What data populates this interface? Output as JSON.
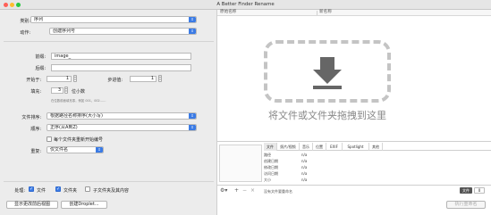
{
  "window": {
    "title": "A Better Finder Rename"
  },
  "form": {
    "category_label": "类别:",
    "category_value": "序列",
    "action_label": "动作:",
    "action_value": "创建序列号",
    "prefix_label": "前缀:",
    "prefix_value": "image_",
    "suffix_label": "后缀:",
    "suffix_value": "",
    "start_label": "开始于:",
    "start_value": "1",
    "step_label": "步进值:",
    "step_value": "1",
    "digits_label": "填充:",
    "digits_value": "3",
    "digits_unit": "位小数",
    "hint_text": "在位数前面填充零，例如 001、002……",
    "sort_label": "文件排序:",
    "sort_value": "根据路径名称排序(大小写)",
    "order_label": "顺序:",
    "order_value": "正序(从A到Z)",
    "restart_label": "每个文件夹重新开始编号",
    "scope_label": "重复:",
    "scope_value": "仅文件名"
  },
  "footer": {
    "process_label": "处理:",
    "files_label": "文件",
    "folders_label": "文件夹",
    "subfolders_label": "子文件夹及其内容",
    "show_log_button": "显示更改前后视图",
    "droplet_button": "创建Droplet...",
    "perform_button": "执行重命名"
  },
  "preview": {
    "col_original": "原始名称",
    "col_new": "新名称",
    "drop_text": "将文件或文件夹拖拽到这里"
  },
  "info": {
    "tabs": [
      "文件",
      "照片/视频",
      "音乐",
      "位置",
      "EXIF",
      "Spotlight",
      "其他"
    ],
    "rows": [
      {
        "key": "路径",
        "value": "n/a"
      },
      {
        "key": "创建日期",
        "value": "n/a"
      },
      {
        "key": "修改日期",
        "value": "n/a"
      },
      {
        "key": "访问日期",
        "value": "n/a"
      },
      {
        "key": "大小",
        "value": "n/a"
      }
    ]
  },
  "status": {
    "text": "没有文件要重命名",
    "badge_label": "文件",
    "zoom_value": "0"
  }
}
